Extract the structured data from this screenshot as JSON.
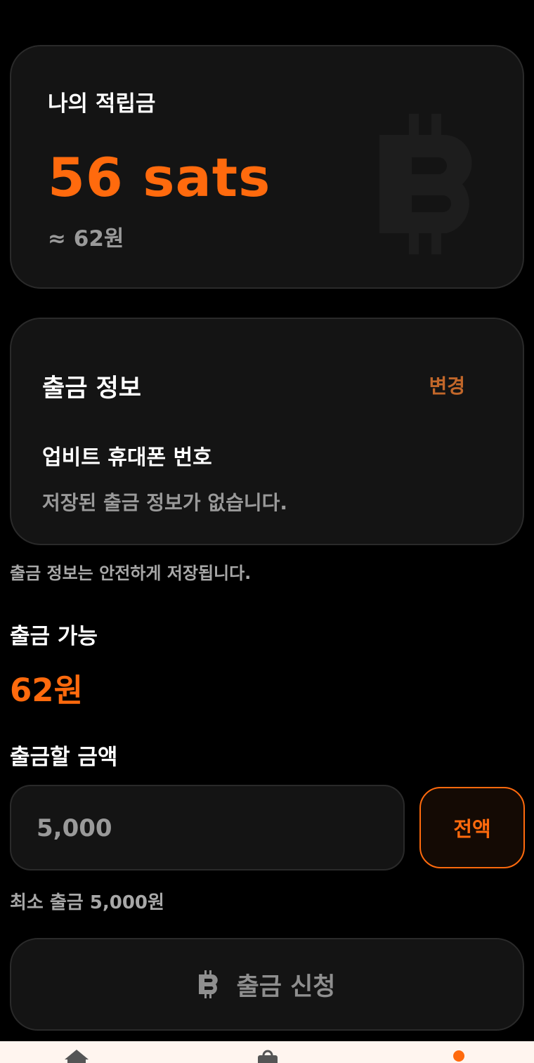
{
  "balance": {
    "title": "나의 적립금",
    "sats": "56 sats",
    "krw": "≈ 62원",
    "watermark_icon": "bitcoin-icon"
  },
  "payout_info": {
    "title": "출금 정보",
    "change_label": "변경",
    "method_label": "업비트 휴대폰 번호",
    "empty_text": "저장된 출금 정보가 없습니다."
  },
  "security_note": "출금 정보는 안전하게 저장됩니다.",
  "available": {
    "label": "출금 가능",
    "value": "62원"
  },
  "amount": {
    "label": "출금할 금액",
    "placeholder": "5,000",
    "value": "",
    "all_label": "전액"
  },
  "minimum_note": "최소 출금 5,000원",
  "submit": {
    "icon": "bitcoin-icon",
    "label": "출금 신청"
  },
  "bottom_nav": {
    "items": [
      "home-icon",
      "shop-bag-icon",
      "profile-icon"
    ],
    "active_color": "#ff6a0d"
  },
  "colors": {
    "accent": "#ff6a0d",
    "background": "#000000",
    "card": "#141414",
    "muted_text": "#9a9a9a"
  }
}
